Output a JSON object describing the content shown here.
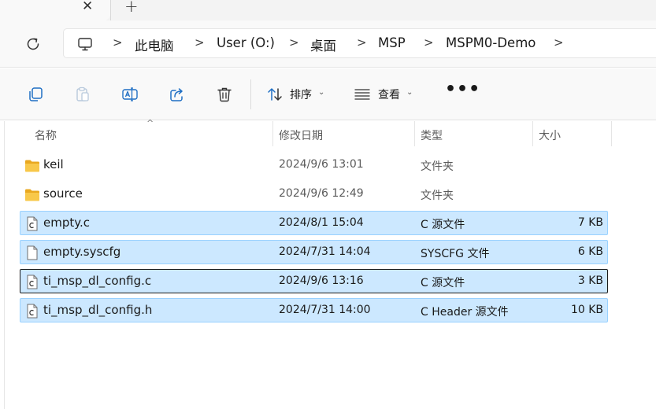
{
  "tab": {
    "close_glyph": "✕",
    "new_glyph": "+"
  },
  "breadcrumb": {
    "items": [
      "此电脑",
      "User (O:)",
      "桌面",
      "MSP",
      "MSPM0-Demo"
    ],
    "separator": ">"
  },
  "toolbar": {
    "sort_label": "排序",
    "view_label": "查看",
    "more_label": "•••",
    "caret": "⌄"
  },
  "columns": {
    "name": "名称",
    "modified": "修改日期",
    "type": "类型",
    "size": "大小",
    "sort_indicator": "^"
  },
  "files": [
    {
      "name": "keil",
      "modified": "2024/9/6 13:01",
      "type": "文件夹",
      "size": "",
      "icon": "folder-icon",
      "selected": false
    },
    {
      "name": "source",
      "modified": "2024/9/6 12:49",
      "type": "文件夹",
      "size": "",
      "icon": "folder-icon",
      "selected": false
    },
    {
      "name": "empty.c",
      "modified": "2024/8/1 15:04",
      "type": "C 源文件",
      "size": "7 KB",
      "icon": "c-file-icon",
      "selected": true
    },
    {
      "name": "empty.syscfg",
      "modified": "2024/7/31 14:04",
      "type": "SYSCFG 文件",
      "size": "6 KB",
      "icon": "blank-file-icon",
      "selected": true
    },
    {
      "name": "ti_msp_dl_config.c",
      "modified": "2024/9/6 13:16",
      "type": "C 源文件",
      "size": "3 KB",
      "icon": "c-file-icon",
      "selected": true,
      "focused": true
    },
    {
      "name": "ti_msp_dl_config.h",
      "modified": "2024/7/31 14:00",
      "type": "C Header 源文件",
      "size": "10 KB",
      "icon": "c-file-icon",
      "selected": true
    }
  ],
  "colors": {
    "selection_bg": "#cce8ff",
    "selection_border": "#99d1ff",
    "folder": "#f8c84a",
    "accent": "#0067c0"
  }
}
